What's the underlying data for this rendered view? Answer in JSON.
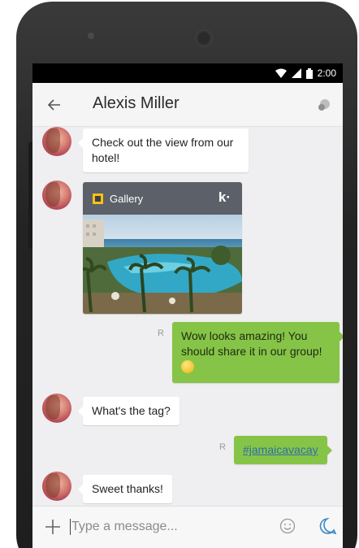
{
  "status_bar": {
    "time": "2:00"
  },
  "header": {
    "contact_name": "Alexis Miller"
  },
  "messages": [
    {
      "direction": "incoming",
      "text": "Check out the view from our hotel!"
    },
    {
      "direction": "incoming",
      "type": "image",
      "card_title": "Gallery",
      "brand_mark": "k·"
    },
    {
      "direction": "outgoing",
      "text": "Wow looks amazing! You should share it in our group!",
      "read_receipt": "R"
    },
    {
      "direction": "incoming",
      "text": "What's the tag?"
    },
    {
      "direction": "outgoing",
      "text": "#jamaicavacay",
      "read_receipt": "R"
    },
    {
      "direction": "incoming",
      "text": "Sweet thanks!"
    }
  ],
  "composer": {
    "placeholder": "Type a message..."
  },
  "colors": {
    "outgoing_bubble": "#86c448",
    "incoming_bubble": "#ffffff",
    "accent": "#3d86c6"
  },
  "icons": [
    "back-arrow-icon",
    "options-icon",
    "wifi-icon",
    "signal-icon",
    "battery-icon",
    "gallery-icon",
    "plus-icon",
    "emoji-icon",
    "send-icon"
  ]
}
